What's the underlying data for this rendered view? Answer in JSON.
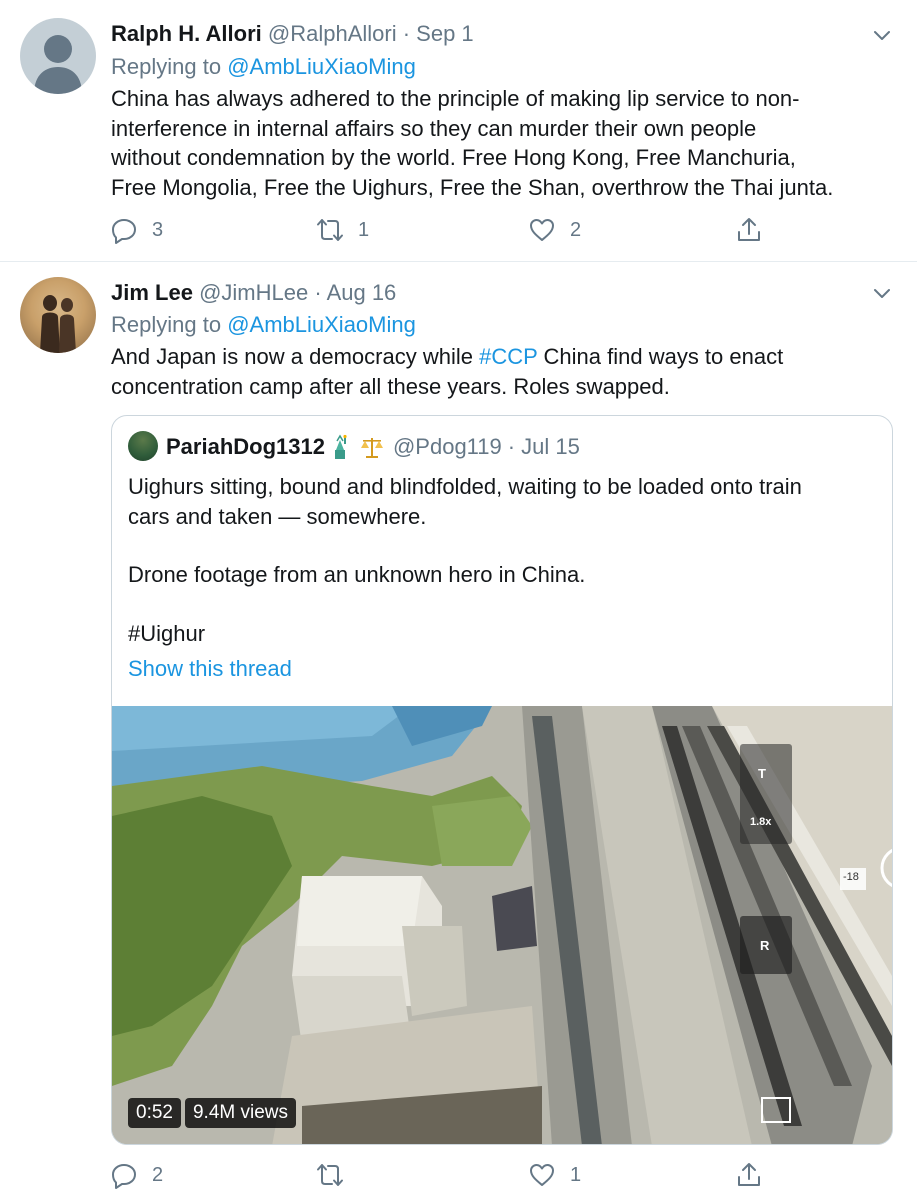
{
  "tweets": [
    {
      "name": "Ralph H. Allori",
      "handle": "@RalphAllori",
      "separator": "·",
      "date": "Sep 1",
      "replying_prefix": "Replying to",
      "replying_to": "@AmbLiuXiaoMing",
      "lines": [
        "China has always adhered to the principle of making lip service to non-",
        "interference in internal affairs so they can murder their own people",
        "without condemnation by the world. Free Hong Kong, Free Manchuria,",
        "Free Mongolia, Free the Uighurs, Free the Shan, overthrow the Thai junta."
      ],
      "replies": "3",
      "retweets": "1",
      "likes": "2"
    },
    {
      "name": "Jim Lee",
      "handle": "@JimHLee",
      "separator": "·",
      "date": "Aug 16",
      "replying_prefix": "Replying to",
      "replying_to": "@AmbLiuXiaoMing",
      "line1_before": "And Japan is now a democracy while",
      "line1_hashtag": "#CCP",
      "line1_after": "China find ways to enact",
      "line2": "concentration camp after all these years. Roles swapped.",
      "replies": "2",
      "retweets": "",
      "likes": "1",
      "quote": {
        "name": "PariahDog1312",
        "handle": "@Pdog119",
        "separator": "·",
        "date": "Jul 15",
        "line1": "Uighurs sitting, bound and blindfolded, waiting to be loaded onto train",
        "line2": "cars and taken — somewhere.",
        "line3": "Drone footage from an unknown hero in China.",
        "line4": "#Uighur",
        "show_thread": "Show this thread",
        "video": {
          "duration": "0:52",
          "views": "9.4M views",
          "overlay_t": "T",
          "overlay_zoom": "1.8x",
          "overlay_r": "R",
          "overlay_num": "-18"
        }
      }
    }
  ],
  "colors": {
    "link": "#1b95e0",
    "secondary_text": "#657786",
    "primary_text": "#14171a",
    "border": "#ccd6dd"
  },
  "icons": [
    "chevron-down-icon",
    "reply-icon",
    "retweet-icon",
    "like-icon",
    "share-icon",
    "statue-of-liberty-emoji",
    "scales-emoji"
  ]
}
